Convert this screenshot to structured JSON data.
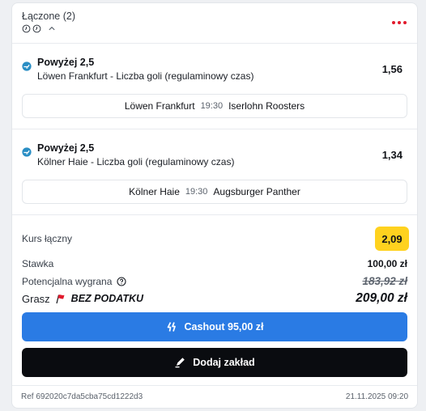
{
  "header": {
    "title": "Łączone (2)"
  },
  "selections": [
    {
      "title": "Powyżej 2,5",
      "market": "Löwen Frankfurt - Liczba goli (regulaminowy czas)",
      "odds": "1,56",
      "home": "Löwen Frankfurt",
      "time": "19:30",
      "away": "Iserlohn Roosters"
    },
    {
      "title": "Powyżej 2,5",
      "market": "Kölner Haie - Liczba goli (regulaminowy czas)",
      "odds": "1,34",
      "home": "Kölner Haie",
      "time": "19:30",
      "away": "Augsburger Panther"
    }
  ],
  "summary": {
    "kurs_label": "Kurs łączny",
    "kurs_value": "2,09",
    "stawka_label": "Stawka",
    "stawka_value": "100,00 zł",
    "potential_label": "Potencjalna wygrana",
    "potential_value": "183,92 zł",
    "grasz_label": "Grasz",
    "tax_label": "BEZ PODATKU",
    "win_value": "209,00 zł"
  },
  "buttons": {
    "cashout_label": "Cashout 95,00 zł",
    "add_label": "Dodaj zakład"
  },
  "footer": {
    "ref": "Ref 692020c7da5cba75cd1222d3",
    "date": "21.11.2025 09:20"
  },
  "colors": {
    "accent_blue": "#2a7be4",
    "odds_yellow": "#ffd21f",
    "dots_red": "#e11a2c",
    "dark_button": "#0a0c10"
  }
}
